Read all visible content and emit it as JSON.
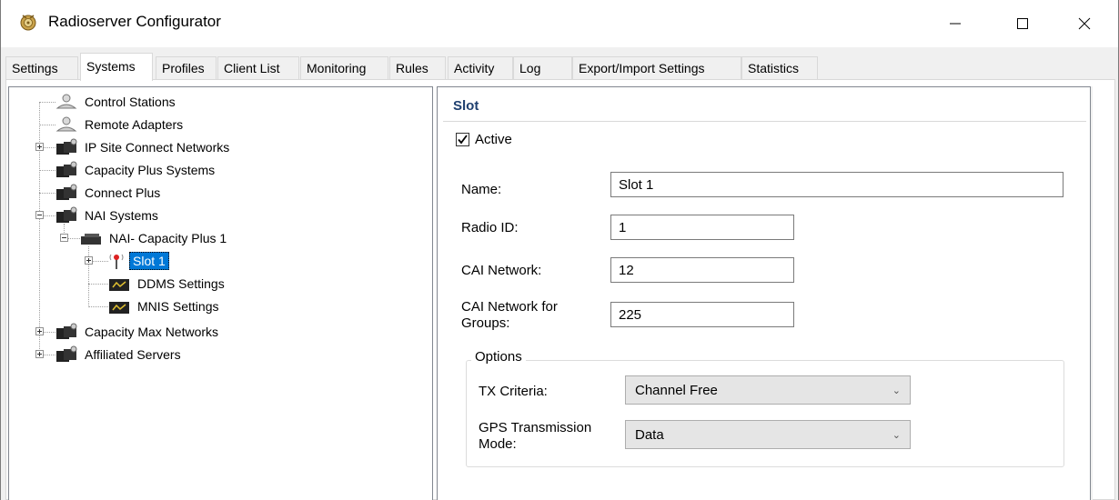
{
  "window": {
    "title": "Radioserver Configurator",
    "controls": {
      "minimize": "—",
      "maximize": "☐",
      "close": "✕"
    }
  },
  "tabs": [
    {
      "label": "Settings",
      "active": false
    },
    {
      "label": "Systems",
      "active": true
    },
    {
      "label": "Profiles",
      "active": false
    },
    {
      "label": "Client List",
      "active": false
    },
    {
      "label": "Monitoring",
      "active": false
    },
    {
      "label": "Rules",
      "active": false
    },
    {
      "label": "Activity",
      "active": false
    },
    {
      "label": "Log",
      "active": false
    },
    {
      "label": "Export/Import Settings",
      "active": false
    },
    {
      "label": "Statistics",
      "active": false
    }
  ],
  "tree": {
    "control_stations": "Control Stations",
    "remote_adapters": "Remote Adapters",
    "ip_site_connect": "IP Site Connect Networks",
    "capacity_plus_systems": "Capacity Plus Systems",
    "connect_plus": "Connect Plus",
    "nai_systems": "NAI Systems",
    "nai_capacity_plus": "NAI- Capacity Plus 1",
    "slot1": "Slot 1",
    "ddms": "DDMS Settings",
    "mnis": "MNIS Settings",
    "capacity_max": "Capacity Max Networks",
    "affiliated_servers": "Affiliated Servers"
  },
  "panel": {
    "title": "Slot",
    "active_label": "Active",
    "active_checked": true,
    "name_label": "Name:",
    "name_value": "Slot 1",
    "radio_id_label": "Radio ID:",
    "radio_id_value": "1",
    "cai_network_label": "CAI Network:",
    "cai_network_value": "12",
    "cai_groups_label_1": "CAI Network for",
    "cai_groups_label_2": "Groups:",
    "cai_groups_value": "225",
    "options_legend": "Options",
    "tx_criteria_label": "TX Criteria:",
    "tx_criteria_value": "Channel Free",
    "gps_label_1": "GPS Transmission",
    "gps_label_2": "Mode:",
    "gps_value": "Data"
  }
}
